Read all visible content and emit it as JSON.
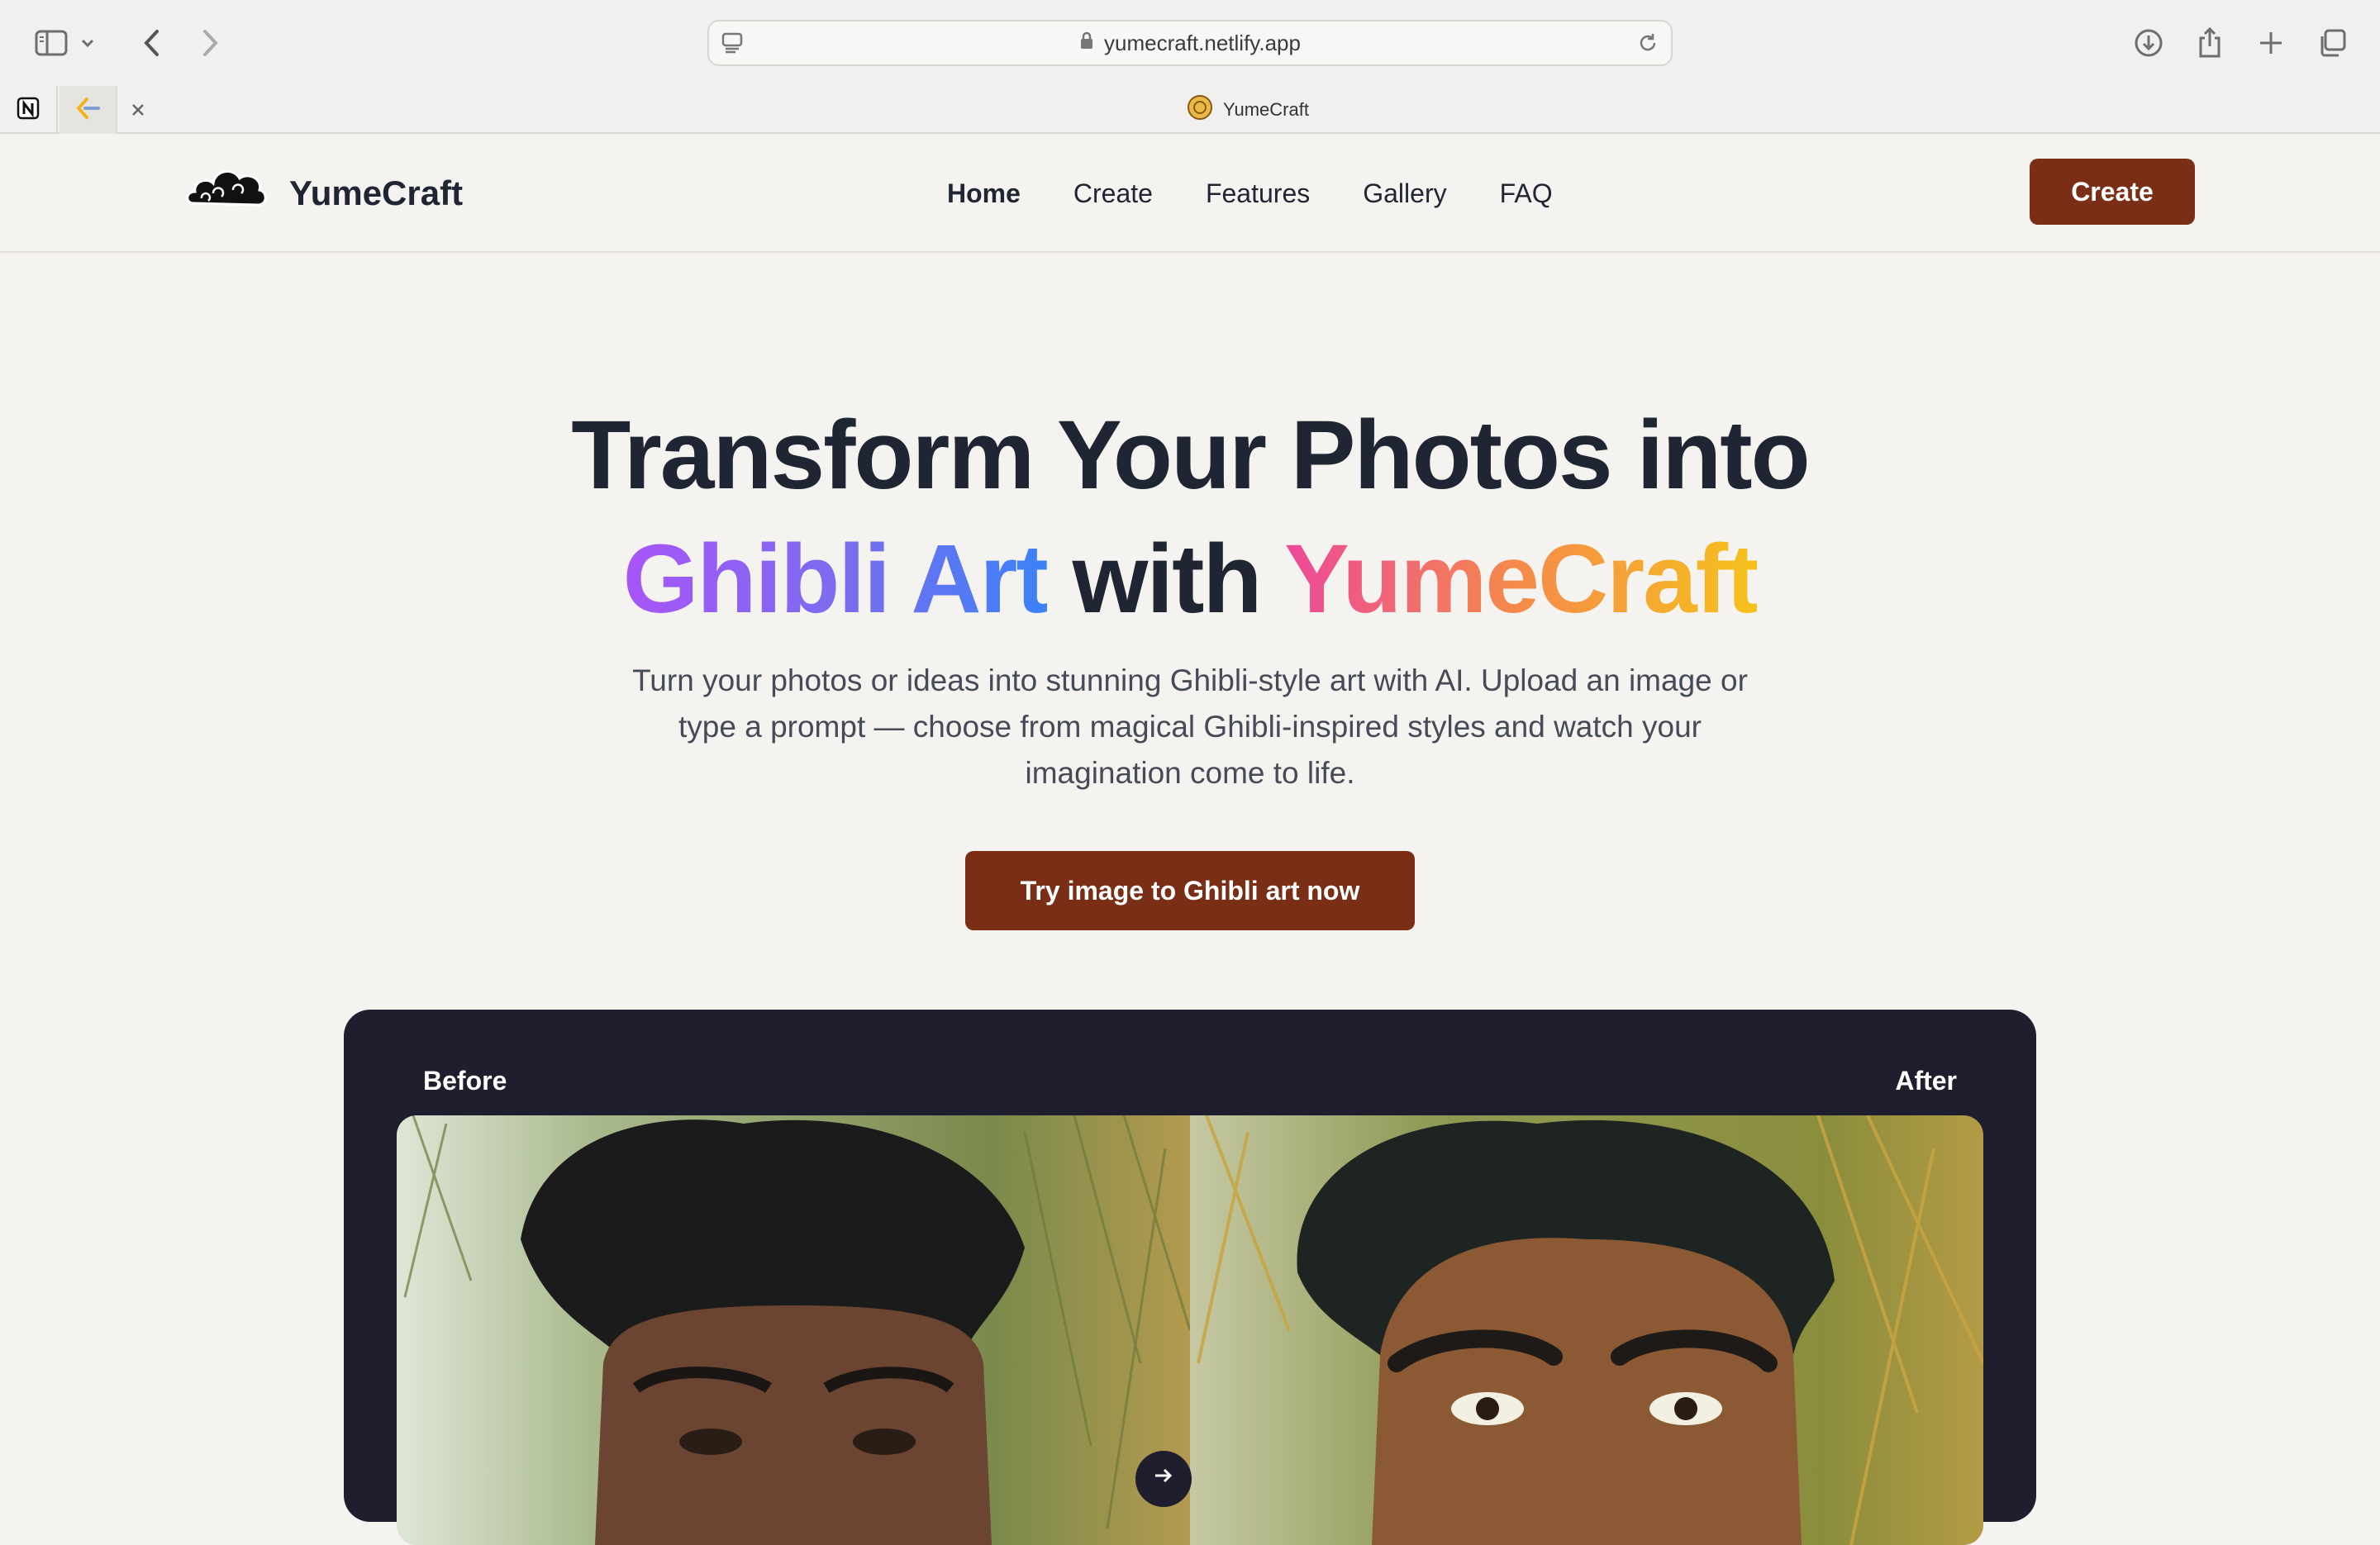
{
  "browser": {
    "url": "yumecraft.netlify.app",
    "active_tab_title": "YumeCraft"
  },
  "site": {
    "brand": "YumeCraft",
    "nav": [
      {
        "label": "Home",
        "active": true
      },
      {
        "label": "Create",
        "active": false
      },
      {
        "label": "Features",
        "active": false
      },
      {
        "label": "Gallery",
        "active": false
      },
      {
        "label": "FAQ",
        "active": false
      }
    ],
    "nav_cta": "Create"
  },
  "hero": {
    "title_line1": "Transform Your Photos into",
    "title_grad1": "Ghibli Art",
    "title_mid": " with ",
    "title_grad2": "YumeCraft",
    "subtitle": "Turn your photos or ideas into stunning Ghibli-style art with AI. Upload an image or type a prompt — choose from magical Ghibli-inspired styles and watch your imagination come to life.",
    "cta": "Try image to Ghibli art now"
  },
  "compare": {
    "before_label": "Before",
    "after_label": "After"
  },
  "colors": {
    "accent": "#7a2e16",
    "dark_panel": "#1f1e2e",
    "page_bg": "#f5f3f0",
    "text": "#1f2533"
  }
}
